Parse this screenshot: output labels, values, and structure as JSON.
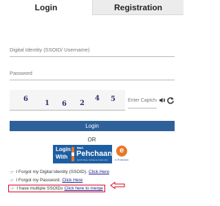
{
  "tabs": [
    {
      "label": "Login",
      "active": true
    },
    {
      "label": "Registration",
      "active": false
    }
  ],
  "form": {
    "ssoid_placeholder": "Digital Identity (SSOID/ Username)",
    "password_placeholder": "Password",
    "captcha_chars": [
      "6",
      "1",
      "6",
      "2",
      "4",
      "5"
    ],
    "captcha_placeholder": "Enter Captcha",
    "login_button": "Login",
    "or_text": "OR"
  },
  "pehchaan": {
    "line1": "Login",
    "line2": "With",
    "meri": "Meri",
    "name": "Pehchaan",
    "tagline": "NATIONAL SINGLE SIGN-ON",
    "right_label": "e-Pramaan"
  },
  "links": [
    {
      "prefix": "I Forgot my Digital Identity (SSOID).",
      "link": "Click Here"
    },
    {
      "prefix": "I Forgot my Password.",
      "link": "Click Here"
    },
    {
      "prefix": "I have multiple SSOIDs",
      "link": "Click here to merge",
      "highlighted": true
    }
  ],
  "icons": {
    "audio": "speaker-icon",
    "refresh": "refresh-icon",
    "hand": "hand-pointing-icon",
    "annotation": "red-arrow-icon"
  },
  "colors": {
    "primary": "#2e6199",
    "highlight_border": "#d4001a",
    "pehchaan_bg": "#1d5ea2",
    "accent_orange": "#e8782a"
  }
}
